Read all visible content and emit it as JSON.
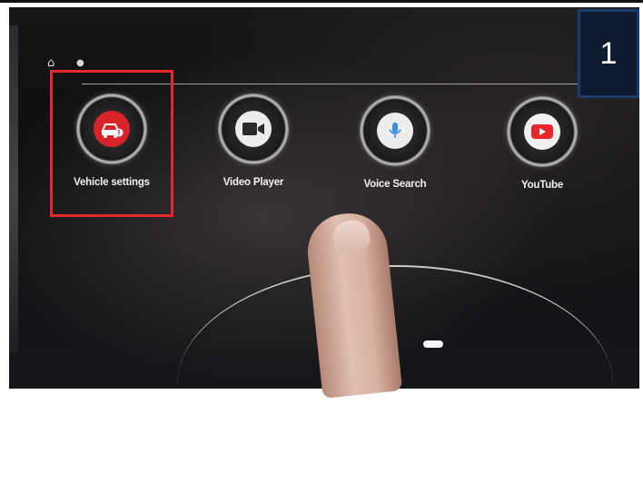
{
  "step": {
    "number": "1"
  },
  "status_icons": [
    {
      "icon": "home-outline-icon",
      "glyph": "⌂"
    },
    {
      "icon": "location-icon",
      "glyph": "●"
    }
  ],
  "apps": [
    {
      "label": "Vehicle settings",
      "icon": "car-alert-icon",
      "color": "#d9232a",
      "highlighted": true
    },
    {
      "label": "Video Player",
      "icon": "video-camera-icon",
      "color": "#ececec",
      "highlighted": false
    },
    {
      "label": "Voice Search",
      "icon": "microphone-icon",
      "color": "#ececec",
      "highlighted": false
    },
    {
      "label": "YouTube",
      "icon": "youtube-play-icon",
      "color": "#e8262d",
      "highlighted": false
    }
  ],
  "colors": {
    "highlight": "#e8262d",
    "badge_bg": "#0e1a2e"
  }
}
